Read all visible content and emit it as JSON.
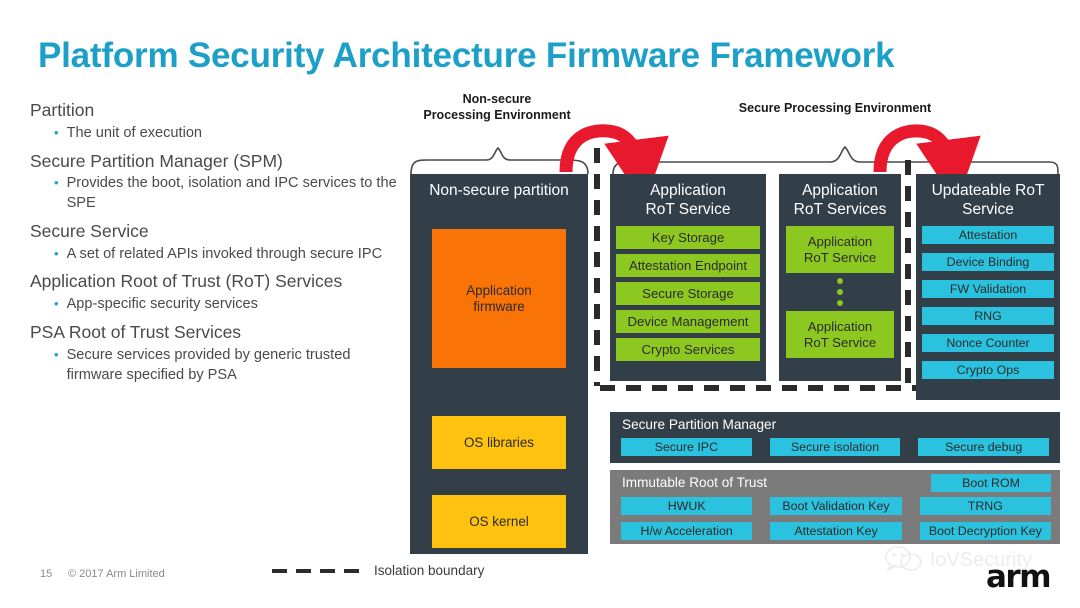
{
  "slide": {
    "title": "Platform Security Architecture Firmware Framework",
    "page_number": "15",
    "copyright": "© 2017 Arm Limited",
    "brand_logo": "arm",
    "watermark_text": "IoVSecurity",
    "accent_color": "#1ca0c8"
  },
  "legend": {
    "label": "Isolation boundary"
  },
  "outline": [
    {
      "heading": "Partition",
      "bullets": [
        "The unit of execution"
      ]
    },
    {
      "heading": "Secure Partition Manager (SPM)",
      "bullets": [
        "Provides the boot, isolation and IPC services to the SPE"
      ]
    },
    {
      "heading": "Secure Service",
      "bullets": [
        "A set of related APIs invoked through secure IPC"
      ]
    },
    {
      "heading": "Application Root of Trust (RoT) Services",
      "bullets": [
        "App-specific security services"
      ]
    },
    {
      "heading": "PSA Root of Trust  Services",
      "bullets": [
        "Secure services provided by generic trusted firmware specified by PSA"
      ]
    }
  ],
  "diagram": {
    "environments": {
      "nonsecure": "Non-secure\nProcessing Environment",
      "nonsecure_line1": "Non-secure",
      "nonsecure_line2": "Processing Environment",
      "secure": "Secure Processing Environment"
    },
    "colors": {
      "panel_dark": "#323e48",
      "panel_gray": "#7b7b7b",
      "green": "#8dc820",
      "cyan": "#2ac2de",
      "yellow": "#ffc20e",
      "orange": "#f97306",
      "arrow_red": "#e8192c"
    },
    "nonsecure_partition": {
      "title": "Non-secure partition",
      "blocks": [
        {
          "label_line1": "Application",
          "label_line2": "firmware",
          "color": "orange"
        },
        {
          "label_line1": "OS libraries",
          "label_line2": "",
          "color": "yellow"
        },
        {
          "label_line1": "OS kernel",
          "label_line2": "",
          "color": "yellow"
        }
      ]
    },
    "application_rot_service": {
      "title_line1": "Application",
      "title_line2": "RoT Service",
      "services": [
        "Key Storage",
        "Attestation Endpoint",
        "Secure Storage",
        "Device Management",
        "Crypto Services"
      ]
    },
    "application_rot_services": {
      "title_line1": "Application",
      "title_line2": "RoT Services",
      "items": [
        {
          "line1": "Application",
          "line2": "RoT Service"
        },
        {
          "line1": "Application",
          "line2": "RoT Service"
        }
      ],
      "ellipsis": "⋮"
    },
    "updateable_rot_service": {
      "title_line1": "Updateable RoT",
      "title_line2": "Service",
      "services": [
        "Attestation",
        "Device Binding",
        "FW Validation",
        "RNG",
        "Nonce Counter",
        "Crypto  Ops"
      ]
    },
    "secure_partition_manager": {
      "title": "Secure Partition Manager",
      "services": [
        "Secure IPC",
        "Secure isolation",
        "Secure debug"
      ]
    },
    "immutable_root_of_trust": {
      "title": "Immutable Root of Trust",
      "top_right": "Boot ROM",
      "grid": [
        "HWUK",
        "Boot Validation Key",
        "TRNG",
        "H/w Acceleration",
        "Attestation Key",
        "Boot Decryption Key"
      ]
    }
  }
}
